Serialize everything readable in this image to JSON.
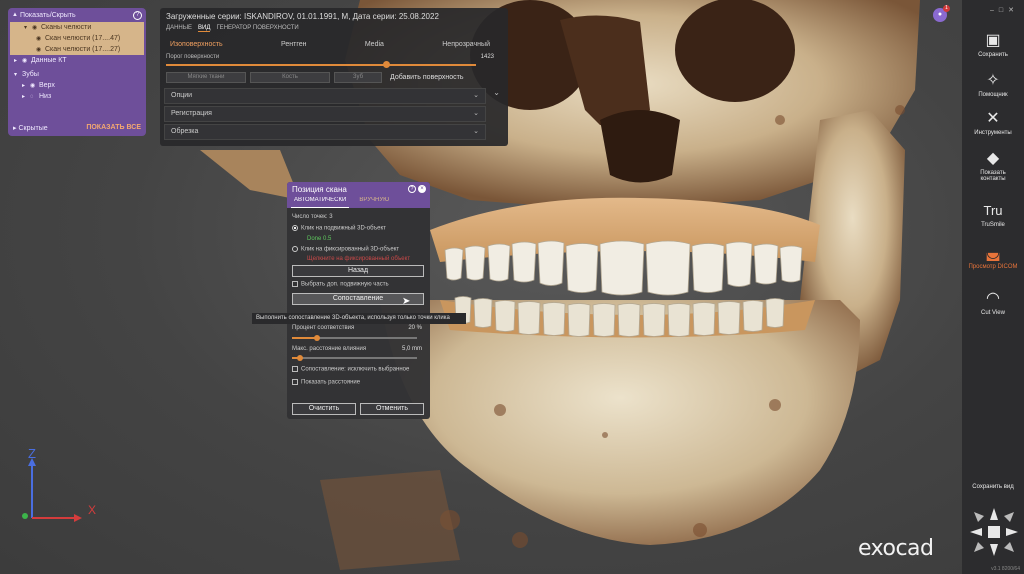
{
  "left_panel": {
    "title": "Показать/Скрыть",
    "items": [
      {
        "label": "Сканы челюсти"
      },
      {
        "label": "Скан челюсти (17....47)"
      },
      {
        "label": "Скан челюсти (17....27)"
      },
      {
        "label": "Данные КТ"
      },
      {
        "label": "Зубы"
      },
      {
        "label": "Верх"
      },
      {
        "label": "Низ"
      }
    ],
    "hidden_label": "Скрытые",
    "show_all_label": "ПОКАЗАТЬ ВСЕ"
  },
  "top_panel": {
    "title": "Загруженные серии: ISKANDIROV, 01.01.1991, M, Дата серии: 25.08.2022",
    "title_red": "",
    "tabs": [
      "ДАННЫЕ",
      "ВИД",
      "ГЕНЕРАТОР ПОВЕРХНОСТИ"
    ],
    "active_tab": "ВИД",
    "modes": [
      "Изоповерхность",
      "Рентген",
      "Media",
      "Непрозрачный"
    ],
    "active_mode": "Изоповерхность",
    "slider_label": "Порог поверхности",
    "slider_value": "1423",
    "slider_fraction": 0.7,
    "buttons": [
      "Мягкие ткани",
      "Кость",
      "Зуб"
    ],
    "add_surface_label": "Добавить поверхность",
    "sections": [
      "Опции",
      "Регистрация",
      "Обрезка"
    ]
  },
  "scan_dialog": {
    "title": "Позиция скана",
    "tabs": [
      "АВТОМАТИЧЕСКИ",
      "ВРУЧНУЮ"
    ],
    "points_count": "Число точек: 3",
    "radio_moving": "Клик на подвижный 3D-объект",
    "moving_status": "Done 0.5",
    "radio_fixed": "Клик на фиксированный 3D-объект",
    "fixed_status": "Щелкните на фиксированный объект",
    "back_button": "Назад",
    "extra_part": "Выбрать доп. подвижную часть",
    "match_button": "Сопоставление",
    "match_percent_label": "Процент соответствия",
    "match_percent_value": "20 %",
    "match_percent_fraction": 0.2,
    "max_dist_label": "Макс. расстояние влияния",
    "max_dist_value": "5,0 mm",
    "max_dist_fraction": 0.06,
    "exclude_label": "Сопоставление: исключить выбранное",
    "show_dist_label": "Показать расстояние",
    "clear_button": "Очистить",
    "cancel_button": "Отменить"
  },
  "tooltip": "Выполнить сопоставление 3D-объекта, используя только точки клика",
  "right_bar": {
    "items": [
      {
        "label": "Сохранить",
        "icon": "save-icon"
      },
      {
        "label": "Помощник",
        "icon": "wand-icon"
      },
      {
        "label": "Инструменты",
        "icon": "tools-icon"
      },
      {
        "label": "Показать контакты",
        "icon": "contacts-icon"
      },
      {
        "label": "TruSmile",
        "icon": "trusmile-icon"
      },
      {
        "label": "Просмотр DICOM",
        "icon": "dicom-icon"
      },
      {
        "label": "Cut View",
        "icon": "cut-view-icon"
      }
    ],
    "active": "Просмотр DICOM",
    "save_view_label": "Сохранить вид",
    "version": "v3.1 8200/64"
  },
  "notifications": {
    "count": "1"
  },
  "axes": {
    "z": "Z",
    "x": "X"
  },
  "brand": "exocad",
  "colors": {
    "accent": "#e8743a",
    "purple": "#6e4f9a",
    "highlight": "#d6b58a"
  }
}
